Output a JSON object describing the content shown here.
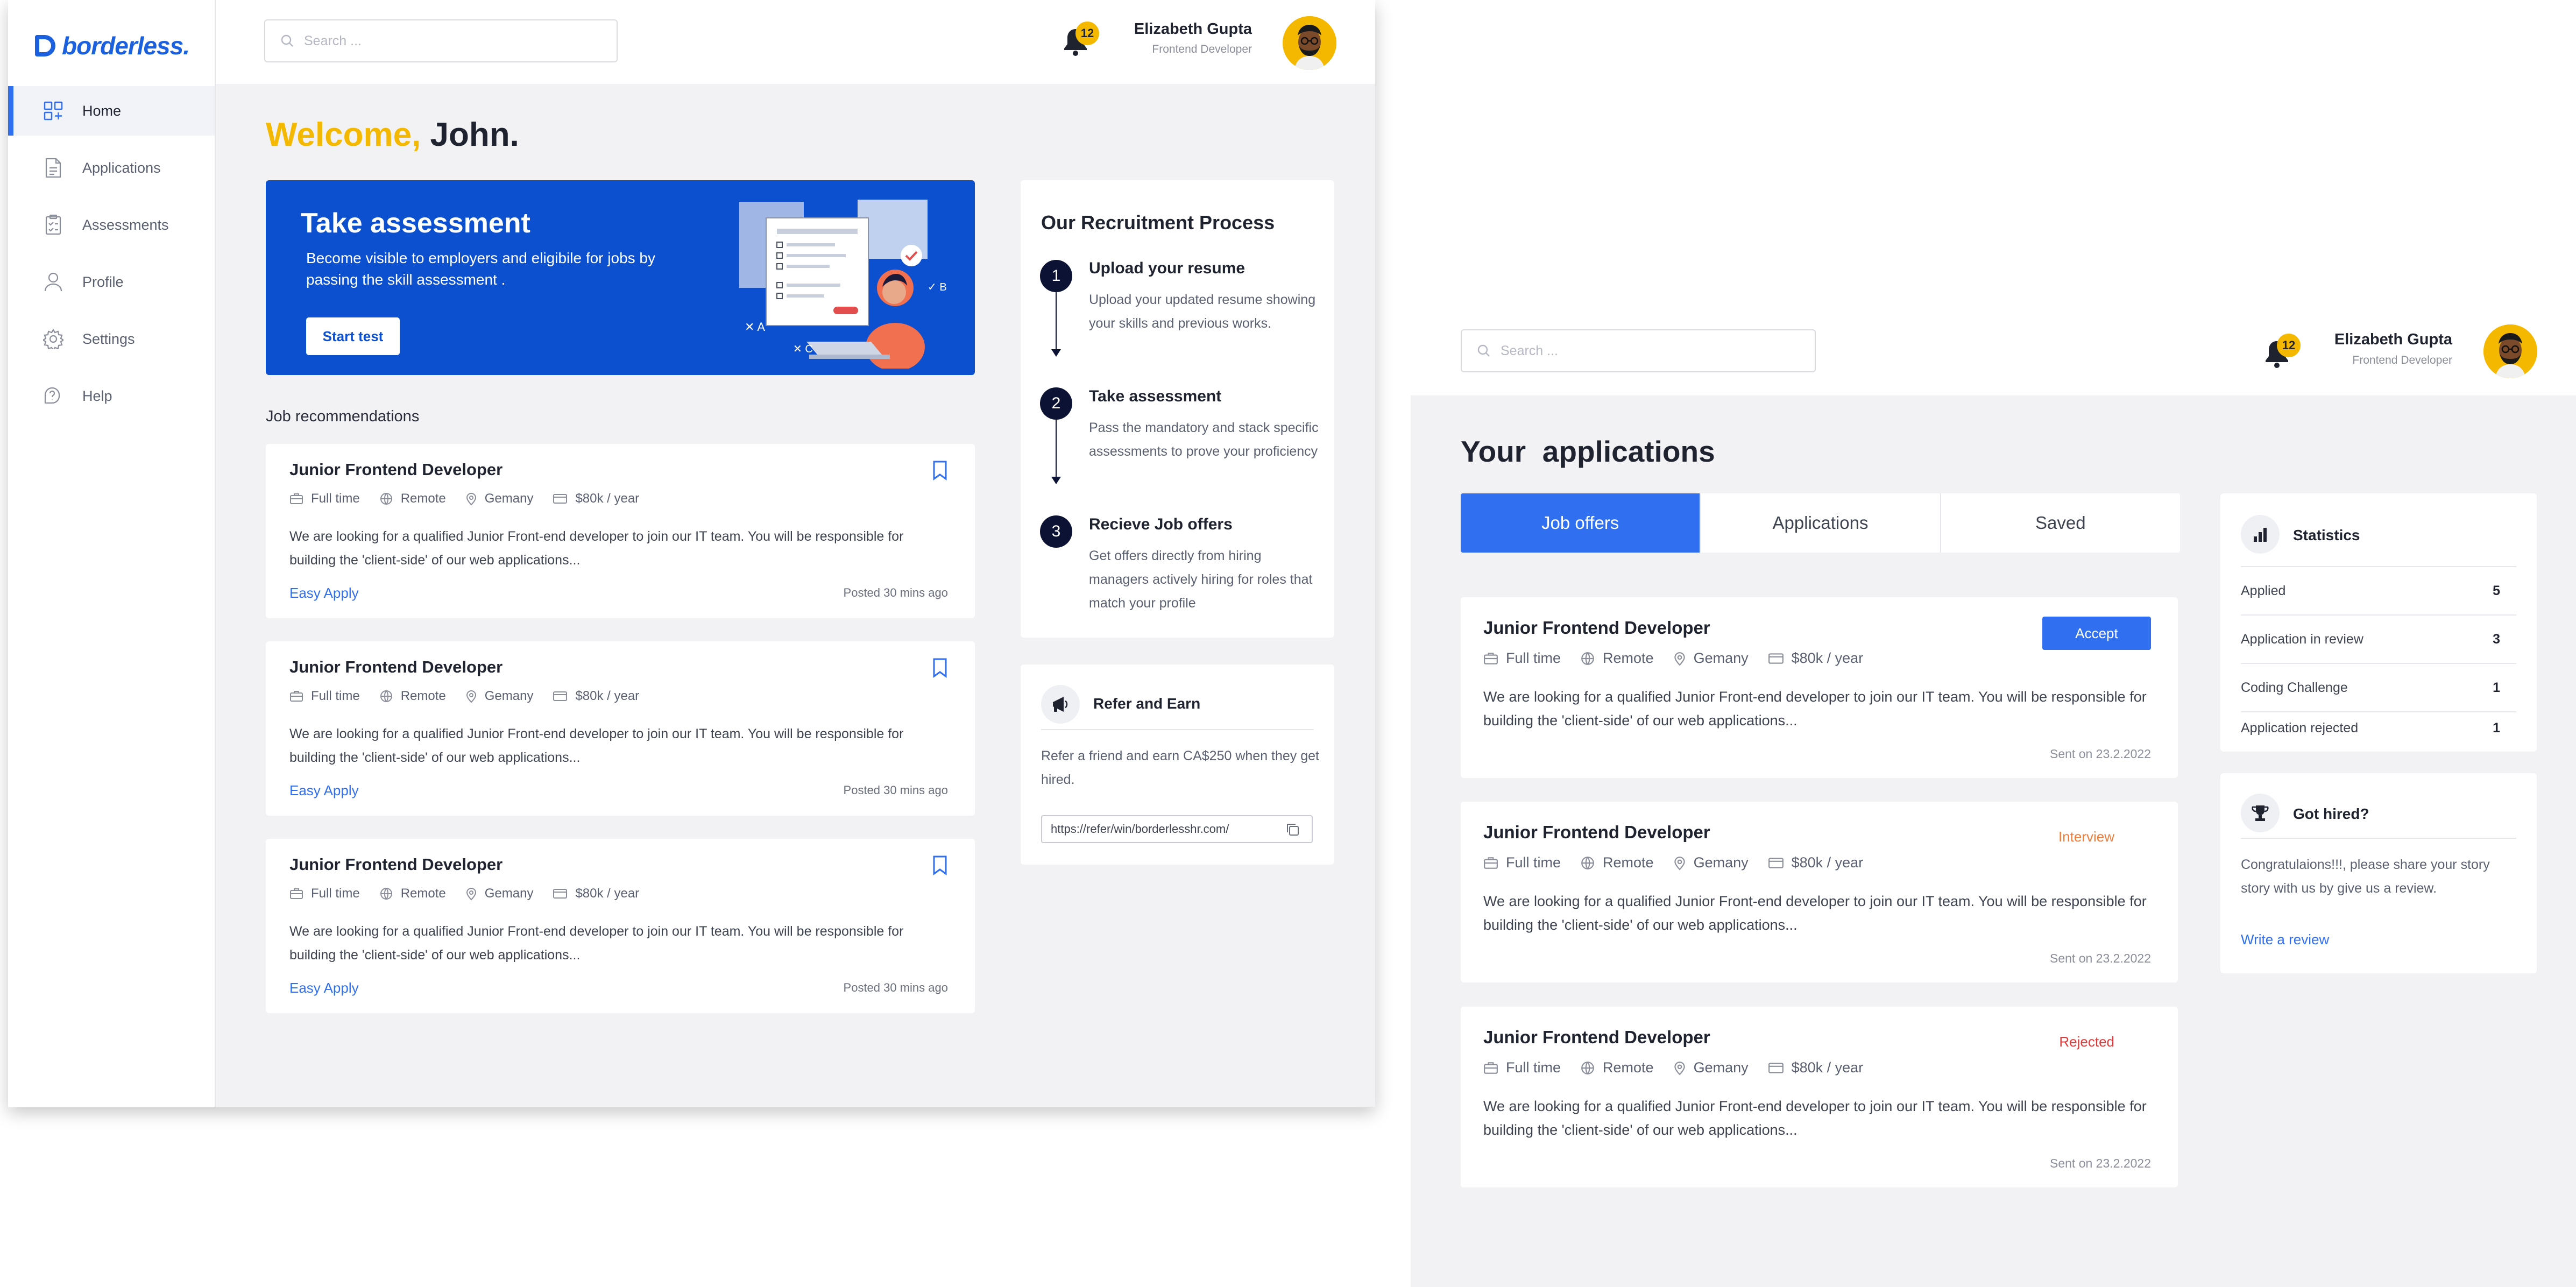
{
  "brand": {
    "name": "borderless."
  },
  "user": {
    "name": "Elizabeth Gupta",
    "role": "Frontend Developer",
    "notifications": "12"
  },
  "search": {
    "placeholder": "Search ..."
  },
  "sidebar": {
    "items": [
      {
        "label": "Home",
        "icon": "home-grid-icon"
      },
      {
        "label": "Applications",
        "icon": "document-icon"
      },
      {
        "label": "Assessments",
        "icon": "clipboard-icon"
      },
      {
        "label": "Profile",
        "icon": "user-icon"
      },
      {
        "label": "Settings",
        "icon": "gear-icon"
      },
      {
        "label": "Help",
        "icon": "help-icon"
      }
    ]
  },
  "dashboard": {
    "welcome_prefix": "Welcome,",
    "welcome_name": "John.",
    "banner": {
      "title": "Take assessment",
      "text": "Become visible to employers and eligibile for jobs by passing the skill assessment .",
      "button": "Start test"
    },
    "recommendations_label": "Job recommendations",
    "jobs": [
      {
        "title": "Junior Frontend Developer",
        "type": "Full time",
        "location_type": "Remote",
        "country": "Gemany",
        "salary": "$80k / year",
        "description": "We are looking for a qualified Junior Front-end developer to join our IT team. You will be responsible for building the 'client-side' of our web applications...",
        "action": "Easy Apply",
        "posted": "Posted 30 mins ago"
      },
      {
        "title": "Junior Frontend Developer",
        "type": "Full time",
        "location_type": "Remote",
        "country": "Gemany",
        "salary": "$80k / year",
        "description": "We are looking for a qualified Junior Front-end developer to join our IT team. You will be responsible for building the 'client-side' of our web applications...",
        "action": "Easy Apply",
        "posted": "Posted 30 mins ago"
      },
      {
        "title": "Junior Frontend Developer",
        "type": "Full time",
        "location_type": "Remote",
        "country": "Gemany",
        "salary": "$80k / year",
        "description": "We are looking for a qualified Junior Front-end developer to join our IT team. You will be responsible for building the 'client-side' of our web applications...",
        "action": "Easy Apply",
        "posted": "Posted 30 mins ago"
      }
    ],
    "process": {
      "title": "Our Recruitment Process",
      "steps": [
        {
          "num": "1",
          "title": "Upload your resume",
          "text": "Upload your updated resume showing your skills and previous works."
        },
        {
          "num": "2",
          "title": "Take assessment",
          "text": "Pass the mandatory and stack specific assessments to prove your proficiency"
        },
        {
          "num": "3",
          "title": "Recieve Job offers",
          "text": "Get offers directly from hiring managers actively hiring for roles that match your profile"
        }
      ]
    },
    "refer": {
      "title": "Refer and Earn",
      "text": "Refer a friend and earn CA$250 when they get hired.",
      "link": "https://refer/win/borderlesshr.com/"
    }
  },
  "applications_page": {
    "title": "Your  applications",
    "tabs": [
      "Job offers",
      "Applications",
      "Saved"
    ],
    "cards": [
      {
        "title": "Junior Frontend Developer",
        "type": "Full time",
        "location_type": "Remote",
        "country": "Gemany",
        "salary": "$80k / year",
        "description": "We are looking for a qualified Junior Front-end developer to join our IT team. You will be responsible for building the 'client-side' of our web applications...",
        "status": "Accept",
        "sent": "Sent on 23.2.2022"
      },
      {
        "title": "Junior Frontend Developer",
        "type": "Full time",
        "location_type": "Remote",
        "country": "Gemany",
        "salary": "$80k / year",
        "description": "We are looking for a qualified Junior Front-end developer to join our IT team. You will be responsible for building the 'client-side' of our web applications...",
        "status": "Interview",
        "sent": "Sent on 23.2.2022"
      },
      {
        "title": "Junior Frontend Developer",
        "type": "Full time",
        "location_type": "Remote",
        "country": "Gemany",
        "salary": "$80k / year",
        "description": "We are looking for a qualified Junior Front-end developer to join our IT team. You will be responsible for building the 'client-side' of our web applications...",
        "status": "Rejected",
        "sent": "Sent on 23.2.2022"
      }
    ],
    "statistics": {
      "title": "Statistics",
      "rows": [
        {
          "label": "Applied",
          "value": "5"
        },
        {
          "label": "Application in review",
          "value": "3"
        },
        {
          "label": "Coding Challenge",
          "value": "1"
        },
        {
          "label": "Application rejected",
          "value": "1"
        }
      ]
    },
    "hired": {
      "title": "Got hired?",
      "text": "Congratulaions!!!, please share your story story with us by give us a review.",
      "link": "Write a review"
    }
  },
  "colors": {
    "accent": "#2f6ff0",
    "brand": "#1b61df",
    "banner": "#0c4fcf",
    "highlight": "#f5b800",
    "interview": "#f07c3a",
    "rejected": "#e03b3b",
    "step": "#0b1233"
  }
}
